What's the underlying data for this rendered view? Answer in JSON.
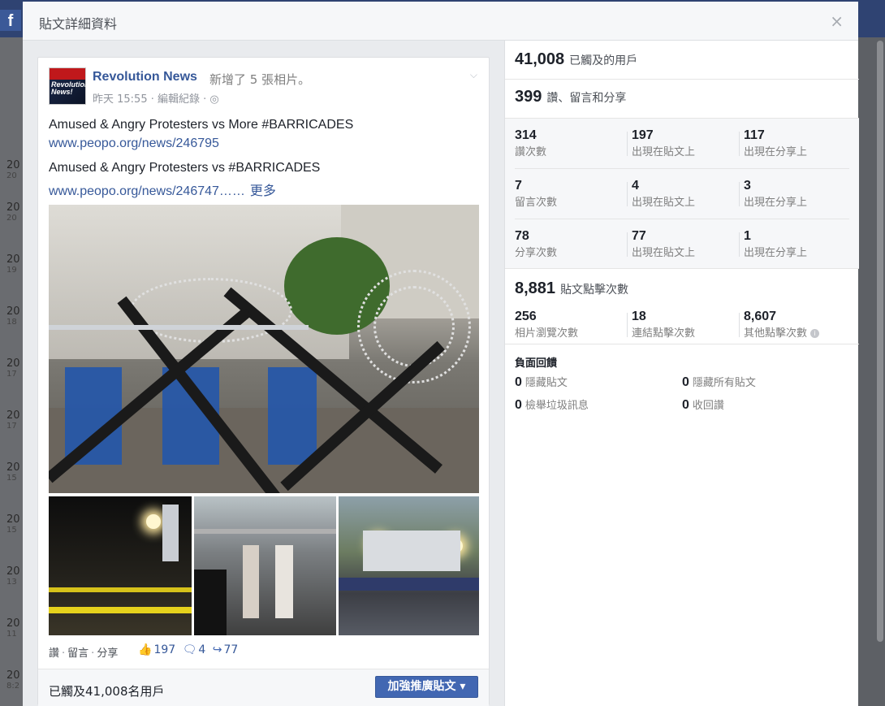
{
  "background": {
    "left_rows": [
      {
        "year": "20",
        "sub": "20"
      },
      {
        "year": "20",
        "sub": "20"
      },
      {
        "year": "20",
        "sub": "19"
      },
      {
        "year": "20",
        "sub": "18"
      },
      {
        "year": "20",
        "sub": "17"
      },
      {
        "year": "20",
        "sub": "17"
      },
      {
        "year": "20",
        "sub": "15"
      },
      {
        "year": "20",
        "sub": "15"
      },
      {
        "year": "20",
        "sub": "13"
      },
      {
        "year": "20",
        "sub": "11"
      },
      {
        "year": "20",
        "sub": "8:2"
      },
      {
        "year": "20",
        "sub": ""
      }
    ]
  },
  "dialog": {
    "title": "貼文詳細資料",
    "close": "×"
  },
  "post": {
    "author": "Revolution News",
    "action": "新增了 5 張相片。",
    "meta": "昨天 15:55 · 編輯紀錄 · ",
    "avatar_text": "Revolution News!",
    "line1": "Amused & Angry Protesters vs More #BARRICADES",
    "link1": "www.peopo.org/news/246795",
    "line2": "Amused & Angry Protesters vs #BARRICADES",
    "link2": "www.peopo.org/news/246747……",
    "more": "更多",
    "actions": {
      "like": "讚",
      "comment": "留言",
      "share": "分享"
    },
    "counts": {
      "likes": "197",
      "comments": "4",
      "shares": "77"
    },
    "reach_text": "已觸及41,008名用戶",
    "boost_button": "加強推廣貼文 ▾"
  },
  "stats": {
    "reach": {
      "value": "41,008",
      "label": "已觸及的用戶"
    },
    "engagement": {
      "value": "399",
      "label": "讚、留言和分享"
    },
    "rows": [
      [
        {
          "num": "314",
          "lbl": "讚次數"
        },
        {
          "num": "197",
          "lbl": "出現在貼文上"
        },
        {
          "num": "117",
          "lbl": "出現在分享上"
        }
      ],
      [
        {
          "num": "7",
          "lbl": "留言次數"
        },
        {
          "num": "4",
          "lbl": "出現在貼文上"
        },
        {
          "num": "3",
          "lbl": "出現在分享上"
        }
      ],
      [
        {
          "num": "78",
          "lbl": "分享次數"
        },
        {
          "num": "77",
          "lbl": "出現在貼文上"
        },
        {
          "num": "1",
          "lbl": "出現在分享上"
        }
      ]
    ],
    "clicks": {
      "value": "8,881",
      "label": "貼文點擊次數"
    },
    "click_rows": [
      {
        "num": "256",
        "lbl": "相片瀏覽次數"
      },
      {
        "num": "18",
        "lbl": "連結點擊次數"
      },
      {
        "num": "8,607",
        "lbl": "其他點擊次數"
      }
    ],
    "negative": {
      "title": "負面回饋",
      "hide_post": {
        "num": "0",
        "lbl": "隱藏貼文"
      },
      "hide_all": {
        "num": "0",
        "lbl": "隱藏所有貼文"
      },
      "report_spam": {
        "num": "0",
        "lbl": "檢舉垃圾訊息"
      },
      "unlike": {
        "num": "0",
        "lbl": "收回讚"
      }
    }
  }
}
